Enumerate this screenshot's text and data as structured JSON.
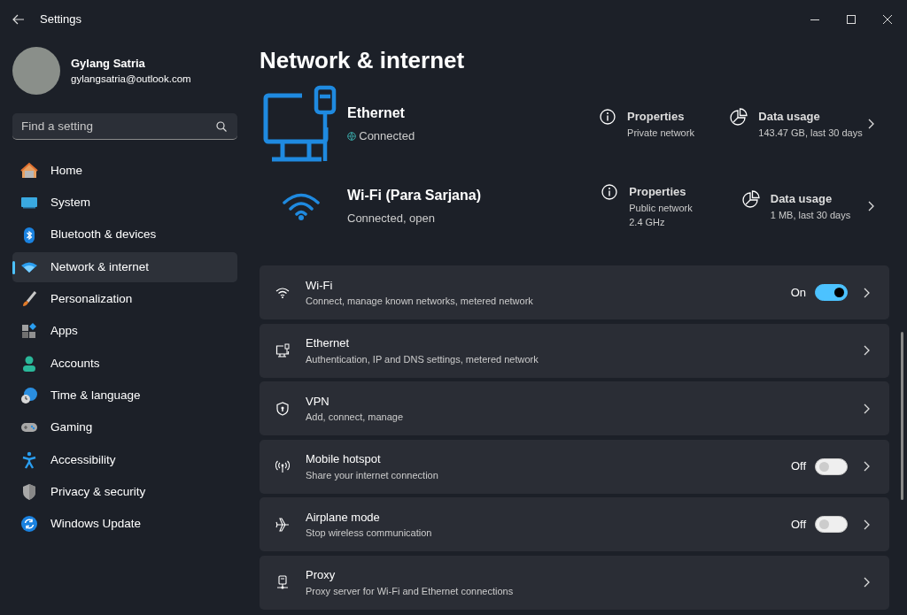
{
  "window": {
    "title": "Settings"
  },
  "account": {
    "name": "Gylang Satria",
    "email": "gylangsatria@outlook.com"
  },
  "search": {
    "placeholder": "Find a setting"
  },
  "sidebar": {
    "items": [
      {
        "label": "Home",
        "selected": false
      },
      {
        "label": "System",
        "selected": false
      },
      {
        "label": "Bluetooth & devices",
        "selected": false
      },
      {
        "label": "Network & internet",
        "selected": true
      },
      {
        "label": "Personalization",
        "selected": false
      },
      {
        "label": "Apps",
        "selected": false
      },
      {
        "label": "Accounts",
        "selected": false
      },
      {
        "label": "Time & language",
        "selected": false
      },
      {
        "label": "Gaming",
        "selected": false
      },
      {
        "label": "Accessibility",
        "selected": false
      },
      {
        "label": "Privacy & security",
        "selected": false
      },
      {
        "label": "Windows Update",
        "selected": false
      }
    ]
  },
  "page_title": "Network & internet",
  "connections": [
    {
      "kind": "ethernet",
      "name": "Ethernet",
      "status": "Connected",
      "properties": {
        "label": "Properties",
        "lines": [
          "Private network"
        ]
      },
      "data_usage": {
        "label": "Data usage",
        "value": "143.47 GB, last 30 days"
      }
    },
    {
      "kind": "wifi",
      "name": "Wi-Fi (Para Sarjana)",
      "status": "Connected, open",
      "properties": {
        "label": "Properties",
        "lines": [
          "Public network",
          "2.4 GHz"
        ]
      },
      "data_usage": {
        "label": "Data usage",
        "value": "1 MB, last 30 days"
      }
    }
  ],
  "settings": [
    {
      "kind": "toggle",
      "title": "Wi-Fi",
      "description": "Connect, manage known networks, metered network",
      "on": true,
      "state_label": "On"
    },
    {
      "kind": "link",
      "title": "Ethernet",
      "description": "Authentication, IP and DNS settings, metered network"
    },
    {
      "kind": "link",
      "title": "VPN",
      "description": "Add, connect, manage"
    },
    {
      "kind": "toggle",
      "title": "Mobile hotspot",
      "description": "Share your internet connection",
      "on": false,
      "state_label": "Off"
    },
    {
      "kind": "toggle",
      "title": "Airplane mode",
      "description": "Stop wireless communication",
      "on": false,
      "state_label": "Off"
    },
    {
      "kind": "link",
      "title": "Proxy",
      "description": "Proxy server for Wi-Fi and Ethernet connections"
    }
  ]
}
